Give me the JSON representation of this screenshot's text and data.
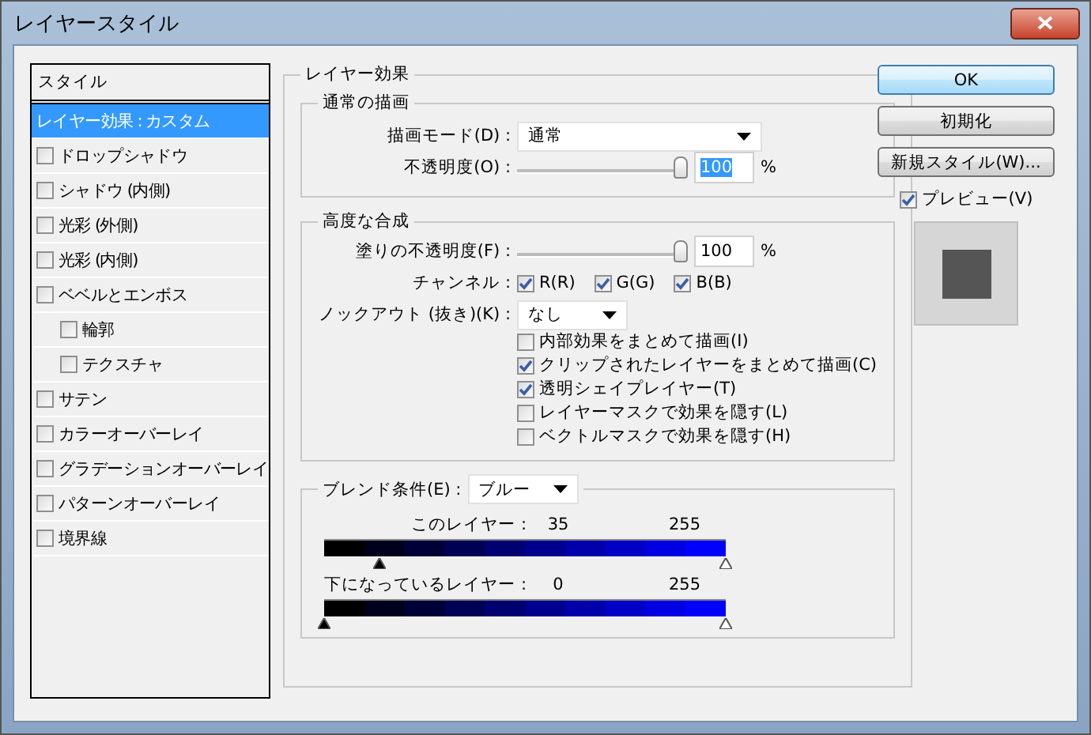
{
  "window": {
    "title": "レイヤースタイル"
  },
  "styles_list": {
    "header": "スタイル",
    "items": [
      {
        "kind": "heading",
        "label": "レイヤー効果 : カスタム",
        "selected": true
      },
      {
        "kind": "checkbox",
        "label": "ドロップシャドウ",
        "checked": false,
        "selected": false
      },
      {
        "kind": "checkbox",
        "label": "シャドウ (内側)",
        "checked": false,
        "selected": false
      },
      {
        "kind": "checkbox",
        "label": "光彩 (外側)",
        "checked": false,
        "selected": false
      },
      {
        "kind": "checkbox",
        "label": "光彩 (内側)",
        "checked": false,
        "selected": false
      },
      {
        "kind": "checkbox",
        "label": "ベベルとエンボス",
        "checked": false,
        "selected": false,
        "children": [
          {
            "kind": "checkbox",
            "label": "輪郭",
            "checked": false,
            "selected": false
          },
          {
            "kind": "checkbox",
            "label": "テクスチャ",
            "checked": false,
            "selected": false
          }
        ]
      },
      {
        "kind": "checkbox",
        "label": "サテン",
        "checked": false,
        "selected": false
      },
      {
        "kind": "checkbox",
        "label": "カラーオーバーレイ",
        "checked": false,
        "selected": false
      },
      {
        "kind": "checkbox",
        "label": "グラデーションオーバーレイ",
        "checked": false,
        "selected": false
      },
      {
        "kind": "checkbox",
        "label": "パターンオーバーレイ",
        "checked": false,
        "selected": false
      },
      {
        "kind": "checkbox",
        "label": "境界線",
        "checked": false,
        "selected": false
      }
    ]
  },
  "layer_effects": {
    "title": "レイヤー効果",
    "normal": {
      "title": "通常の描画",
      "blend_mode": {
        "label": "描画モード(D) :",
        "value": "通常"
      },
      "opacity": {
        "label": "不透明度(O) :",
        "level": 1,
        "value": "100",
        "selected": true,
        "unit": "%"
      }
    },
    "advanced": {
      "title": "高度な合成",
      "fill_opacity": {
        "label": "塗りの不透明度(F) :",
        "level": 1,
        "value": "100",
        "selected": false,
        "unit": "%"
      },
      "channels": {
        "label": "チャンネル :",
        "items": [
          {
            "label": "R(R)",
            "checked": true
          },
          {
            "label": "G(G)",
            "checked": true
          },
          {
            "label": "B(B)",
            "checked": true
          }
        ]
      },
      "knockout": {
        "label": "ノックアウト (抜き)(K) :",
        "value": "なし"
      },
      "options": [
        {
          "label": "内部効果をまとめて描画(I)",
          "checked": false
        },
        {
          "label": "クリップされたレイヤーをまとめて描画(C)",
          "checked": true
        },
        {
          "label": "透明シェイプレイヤー(T)",
          "checked": true
        },
        {
          "label": "レイヤーマスクで効果を隠す(L)",
          "checked": false
        },
        {
          "label": "ベクトルマスクで効果を隠す(H)",
          "checked": false
        }
      ]
    },
    "blend_if": {
      "label": "ブレンド条件(E) :",
      "value": "ブルー",
      "ranges": [
        {
          "label": "このレイヤー :",
          "low": "35",
          "high": "255",
          "thumbs": [
            {
              "level": 0.137
            },
            {
              "level": 1
            }
          ]
        },
        {
          "label": "下になっているレイヤー :",
          "low": "0",
          "high": "255",
          "thumbs": [
            {
              "level": 0
            },
            {
              "level": 1
            }
          ]
        }
      ]
    }
  },
  "buttons": [
    {
      "label": "OK",
      "default": true
    },
    {
      "label": "初期化",
      "default": false
    },
    {
      "label": "新規スタイル(W)...",
      "default": false
    }
  ],
  "preview": {
    "label": "プレビュー(V)",
    "checked": true
  }
}
